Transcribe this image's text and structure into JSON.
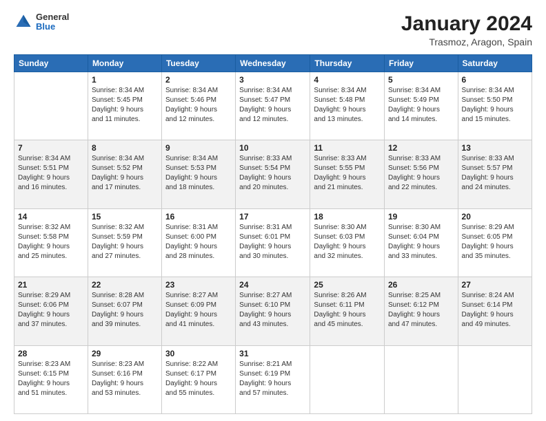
{
  "header": {
    "logo": {
      "general": "General",
      "blue": "Blue"
    },
    "title": "January 2024",
    "subtitle": "Trasmoz, Aragon, Spain"
  },
  "weekdays": [
    "Sunday",
    "Monday",
    "Tuesday",
    "Wednesday",
    "Thursday",
    "Friday",
    "Saturday"
  ],
  "weeks": [
    [
      {
        "day": "",
        "info": ""
      },
      {
        "day": "1",
        "info": "Sunrise: 8:34 AM\nSunset: 5:45 PM\nDaylight: 9 hours\nand 11 minutes."
      },
      {
        "day": "2",
        "info": "Sunrise: 8:34 AM\nSunset: 5:46 PM\nDaylight: 9 hours\nand 12 minutes."
      },
      {
        "day": "3",
        "info": "Sunrise: 8:34 AM\nSunset: 5:47 PM\nDaylight: 9 hours\nand 12 minutes."
      },
      {
        "day": "4",
        "info": "Sunrise: 8:34 AM\nSunset: 5:48 PM\nDaylight: 9 hours\nand 13 minutes."
      },
      {
        "day": "5",
        "info": "Sunrise: 8:34 AM\nSunset: 5:49 PM\nDaylight: 9 hours\nand 14 minutes."
      },
      {
        "day": "6",
        "info": "Sunrise: 8:34 AM\nSunset: 5:50 PM\nDaylight: 9 hours\nand 15 minutes."
      }
    ],
    [
      {
        "day": "7",
        "info": "Sunrise: 8:34 AM\nSunset: 5:51 PM\nDaylight: 9 hours\nand 16 minutes."
      },
      {
        "day": "8",
        "info": "Sunrise: 8:34 AM\nSunset: 5:52 PM\nDaylight: 9 hours\nand 17 minutes."
      },
      {
        "day": "9",
        "info": "Sunrise: 8:34 AM\nSunset: 5:53 PM\nDaylight: 9 hours\nand 18 minutes."
      },
      {
        "day": "10",
        "info": "Sunrise: 8:33 AM\nSunset: 5:54 PM\nDaylight: 9 hours\nand 20 minutes."
      },
      {
        "day": "11",
        "info": "Sunrise: 8:33 AM\nSunset: 5:55 PM\nDaylight: 9 hours\nand 21 minutes."
      },
      {
        "day": "12",
        "info": "Sunrise: 8:33 AM\nSunset: 5:56 PM\nDaylight: 9 hours\nand 22 minutes."
      },
      {
        "day": "13",
        "info": "Sunrise: 8:33 AM\nSunset: 5:57 PM\nDaylight: 9 hours\nand 24 minutes."
      }
    ],
    [
      {
        "day": "14",
        "info": "Sunrise: 8:32 AM\nSunset: 5:58 PM\nDaylight: 9 hours\nand 25 minutes."
      },
      {
        "day": "15",
        "info": "Sunrise: 8:32 AM\nSunset: 5:59 PM\nDaylight: 9 hours\nand 27 minutes."
      },
      {
        "day": "16",
        "info": "Sunrise: 8:31 AM\nSunset: 6:00 PM\nDaylight: 9 hours\nand 28 minutes."
      },
      {
        "day": "17",
        "info": "Sunrise: 8:31 AM\nSunset: 6:01 PM\nDaylight: 9 hours\nand 30 minutes."
      },
      {
        "day": "18",
        "info": "Sunrise: 8:30 AM\nSunset: 6:03 PM\nDaylight: 9 hours\nand 32 minutes."
      },
      {
        "day": "19",
        "info": "Sunrise: 8:30 AM\nSunset: 6:04 PM\nDaylight: 9 hours\nand 33 minutes."
      },
      {
        "day": "20",
        "info": "Sunrise: 8:29 AM\nSunset: 6:05 PM\nDaylight: 9 hours\nand 35 minutes."
      }
    ],
    [
      {
        "day": "21",
        "info": "Sunrise: 8:29 AM\nSunset: 6:06 PM\nDaylight: 9 hours\nand 37 minutes."
      },
      {
        "day": "22",
        "info": "Sunrise: 8:28 AM\nSunset: 6:07 PM\nDaylight: 9 hours\nand 39 minutes."
      },
      {
        "day": "23",
        "info": "Sunrise: 8:27 AM\nSunset: 6:09 PM\nDaylight: 9 hours\nand 41 minutes."
      },
      {
        "day": "24",
        "info": "Sunrise: 8:27 AM\nSunset: 6:10 PM\nDaylight: 9 hours\nand 43 minutes."
      },
      {
        "day": "25",
        "info": "Sunrise: 8:26 AM\nSunset: 6:11 PM\nDaylight: 9 hours\nand 45 minutes."
      },
      {
        "day": "26",
        "info": "Sunrise: 8:25 AM\nSunset: 6:12 PM\nDaylight: 9 hours\nand 47 minutes."
      },
      {
        "day": "27",
        "info": "Sunrise: 8:24 AM\nSunset: 6:14 PM\nDaylight: 9 hours\nand 49 minutes."
      }
    ],
    [
      {
        "day": "28",
        "info": "Sunrise: 8:23 AM\nSunset: 6:15 PM\nDaylight: 9 hours\nand 51 minutes."
      },
      {
        "day": "29",
        "info": "Sunrise: 8:23 AM\nSunset: 6:16 PM\nDaylight: 9 hours\nand 53 minutes."
      },
      {
        "day": "30",
        "info": "Sunrise: 8:22 AM\nSunset: 6:17 PM\nDaylight: 9 hours\nand 55 minutes."
      },
      {
        "day": "31",
        "info": "Sunrise: 8:21 AM\nSunset: 6:19 PM\nDaylight: 9 hours\nand 57 minutes."
      },
      {
        "day": "",
        "info": ""
      },
      {
        "day": "",
        "info": ""
      },
      {
        "day": "",
        "info": ""
      }
    ]
  ]
}
